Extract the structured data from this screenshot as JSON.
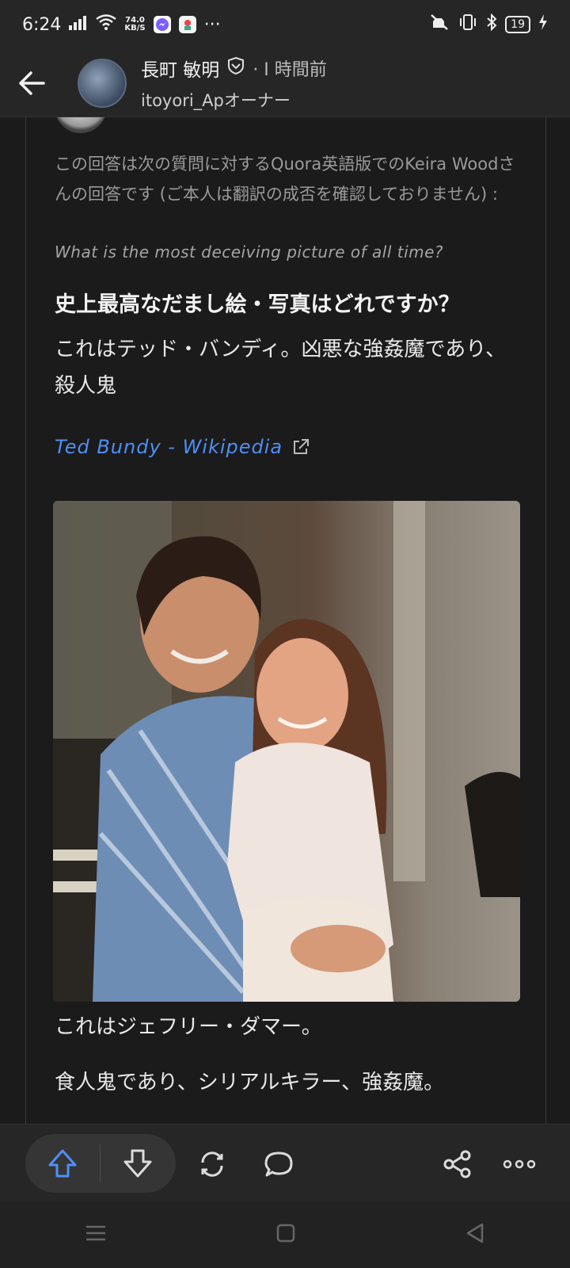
{
  "status_bar": {
    "time": "6:24",
    "net_speed_value": "74.0",
    "net_speed_unit": "KB/S",
    "battery": "19",
    "more": "···"
  },
  "header": {
    "author_name": "長町 敏明",
    "time_ago": "· I 時間前",
    "credential": "itoyori_Apオーナー"
  },
  "content": {
    "note": "この回答は次の質問に対するQuora英語版でのKeira Woodさんの回答です (ご本人は翻訳の成否を確認しておりません) :",
    "note_en": "What is the most deceiving picture of all time?",
    "question": "史上最高なだまし絵・写真はどれですか？",
    "para1": "これはテッド・バンディ。凶悪な強姦魔であり、殺人鬼",
    "link": "Ted Bundy - Wikipedia",
    "para2": "これはジェフリー・ダマー。",
    "para3": "食人鬼であり、シリアルキラー、強姦魔。"
  },
  "colors": {
    "background": "#1b1b1b",
    "bar": "#262626",
    "link": "#4f8ff7",
    "upvote": "#4f8ff7"
  }
}
